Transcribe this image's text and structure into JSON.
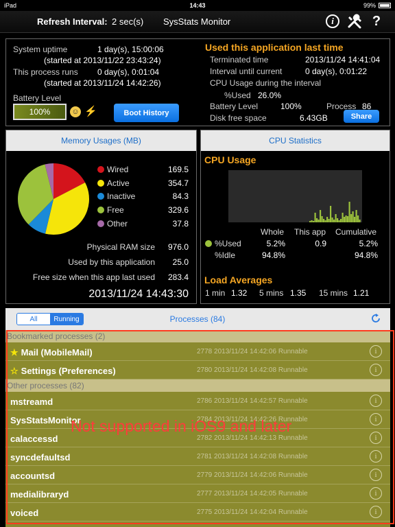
{
  "statusbar": {
    "device": "iPad",
    "time": "14:43",
    "battery": "99%"
  },
  "nav": {
    "refresh_label": "Refresh Interval:",
    "refresh_value": "2 sec(s)",
    "title": "SysStats Monitor"
  },
  "top": {
    "uptime_label": "System uptime",
    "uptime_value": "1 day(s), 15:00:06",
    "uptime_started": "(started at 2013/11/22 23:43:24)",
    "runs_label": "This process runs",
    "runs_value": "0 day(s), 0:01:04",
    "runs_started": "(started at 2013/11/24 14:42:26)",
    "battery_label": "Battery Level",
    "battery_value": "100%",
    "boot_history": "Boot History",
    "last_title": "Used this application last time",
    "terminated_label": "Terminated time",
    "terminated_value": "2013/11/24 14:41:04",
    "interval_label": "Interval until current",
    "interval_value": "0 day(s), 0:01:22",
    "cpu_interval_label": "CPU Usage during the interval",
    "used_label": "%Used",
    "used_value": "26.0%",
    "battery2_label": "Battery Level",
    "battery2_value": "100%",
    "process_label": "Process",
    "process_value": "86",
    "disk_label": "Disk free space",
    "disk_value": "6.43GB",
    "share": "Share"
  },
  "memory": {
    "header": "Memory Usages (MB)",
    "legend": [
      {
        "label": "Wired",
        "value": "169.5",
        "color": "#d4141c"
      },
      {
        "label": "Active",
        "value": "354.7",
        "color": "#f5e50a"
      },
      {
        "label": "Inactive",
        "value": "84.3",
        "color": "#1a8ad8"
      },
      {
        "label": "Free",
        "value": "329.6",
        "color": "#9cc23c"
      },
      {
        "label": "Other",
        "value": "37.8",
        "color": "#a66aa8"
      }
    ],
    "physical_label": "Physical RAM size",
    "physical_value": "976.0",
    "used_app_label": "Used by this application",
    "used_app_value": "25.0",
    "free_last_label": "Free size when this app last used",
    "free_last_value": "283.4",
    "timestamp": "2013/11/24 14:43:30"
  },
  "cpu": {
    "header": "CPU Statistics",
    "usage_title": "CPU Usage",
    "col_whole": "Whole",
    "col_app": "This app",
    "col_cumulative": "Cumulative",
    "used_label": "%Used",
    "used_whole": "5.2%",
    "used_app": "0.9",
    "used_cum": "5.2%",
    "idle_label": "%Idle",
    "idle_whole": "94.8%",
    "idle_cum": "94.8%",
    "load_title": "Load Averages",
    "load_1_label": "1 min",
    "load_1": "1.32",
    "load_5_label": "5 mins",
    "load_5": "1.35",
    "load_15_label": "15 mins",
    "load_15": "1.21",
    "graph_bars": [
      2,
      3,
      2,
      14,
      6,
      4,
      18,
      9,
      5,
      3,
      8,
      5,
      24,
      7,
      4,
      12,
      6,
      3,
      5,
      14,
      8,
      10,
      9,
      30,
      12,
      16,
      8,
      18,
      10,
      4
    ]
  },
  "processes": {
    "seg_all": "All",
    "seg_running": "Running",
    "title": "Processes (84)",
    "bookmarked_header": "Bookmarked processes (2)",
    "other_header": "Other processes (82)",
    "bookmarked": [
      {
        "star": "★",
        "name": "Mail (MobileMail)",
        "meta": "2778 2013/11/24 14:42:06 Runnable"
      },
      {
        "star": "☆",
        "name": "Settings (Preferences)",
        "meta": "2780 2013/11/24 14:42:08 Runnable"
      }
    ],
    "others": [
      {
        "name": "mstreamd",
        "meta": "2786 2013/11/24 14:42:57 Runnable"
      },
      {
        "name": "SysStatsMonitor",
        "meta": "2784 2013/11/24 14:42:26 Runnable"
      },
      {
        "name": "calaccessd",
        "meta": "2782 2013/11/24 14:42:13 Runnable"
      },
      {
        "name": "syncdefaultsd",
        "meta": "2781 2013/11/24 14:42:08 Runnable"
      },
      {
        "name": "accountsd",
        "meta": "2779 2013/11/24 14:42:06 Runnable"
      },
      {
        "name": "medialibraryd",
        "meta": "2777 2013/11/24 14:42:05 Runnable"
      },
      {
        "name": "voiced",
        "meta": "2775 2013/11/24 14:42:04 Runnable"
      }
    ],
    "overlay_text": "Not supported in iOS9 and later"
  }
}
